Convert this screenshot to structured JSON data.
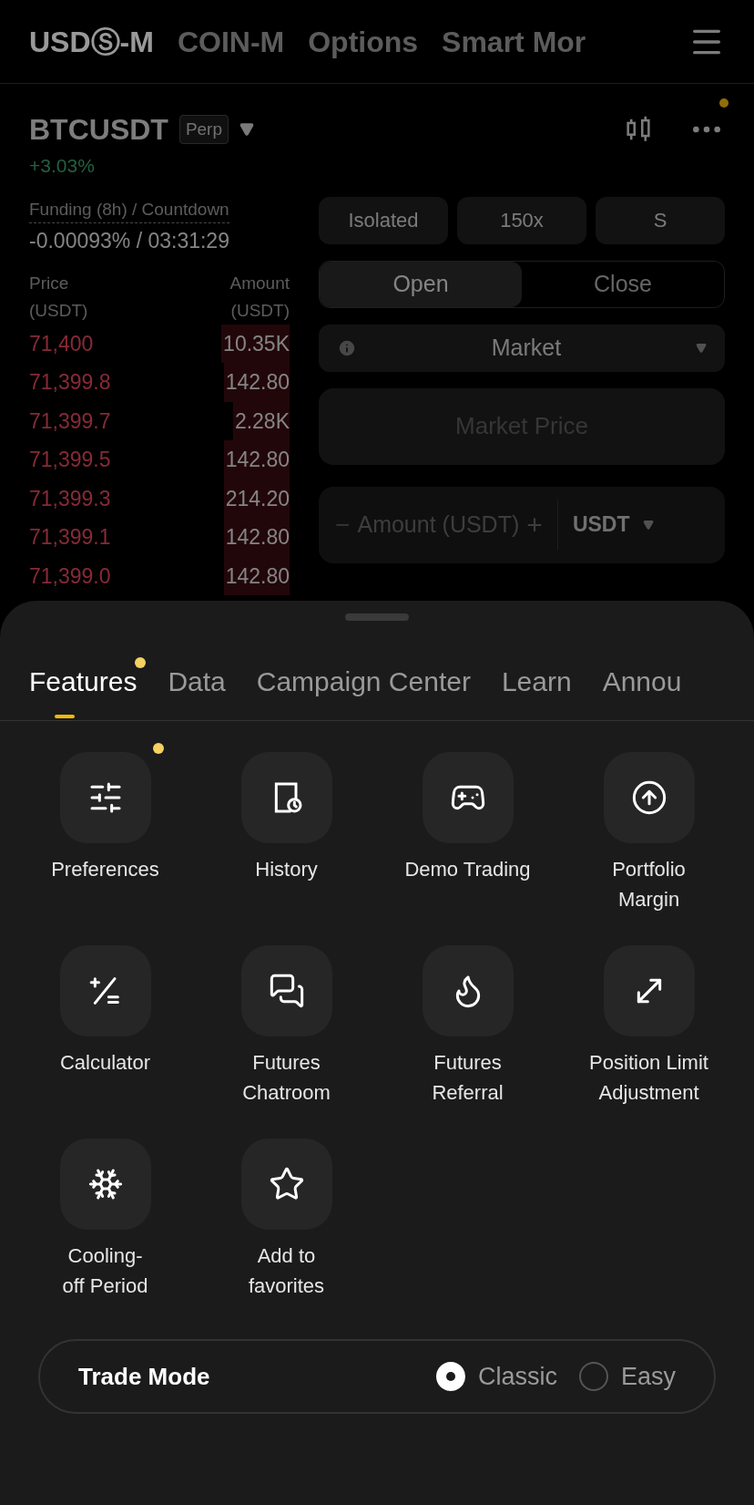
{
  "top_tabs": [
    {
      "label": "USDⓈ-M",
      "selected": true
    },
    {
      "label": "COIN-M",
      "selected": false
    },
    {
      "label": "Options",
      "selected": false
    },
    {
      "label": "Smart Mor",
      "selected": false
    }
  ],
  "symbol": {
    "name": "BTCUSDT",
    "badge": "Perp",
    "change": "+3.03%",
    "more_notification": true
  },
  "funding": {
    "label": "Funding (8h) / Countdown",
    "value": "-0.00093% / 03:31:29"
  },
  "order_book": {
    "columns": [
      "Price\n(USDT)",
      "Amount\n(USDT)"
    ],
    "rows": [
      {
        "price": "71,400",
        "amount": "10.35K"
      },
      {
        "price": "71,399.8",
        "amount": "142.80"
      },
      {
        "price": "71,399.7",
        "amount": "2.28K"
      },
      {
        "price": "71,399.5",
        "amount": "142.80"
      },
      {
        "price": "71,399.3",
        "amount": "214.20"
      },
      {
        "price": "71,399.1",
        "amount": "142.80"
      },
      {
        "price": "71,399.0",
        "amount": "142.80"
      }
    ]
  },
  "order_form": {
    "margin_buttons": [
      "Isolated",
      "150x",
      "S"
    ],
    "sides": [
      {
        "label": "Open",
        "selected": true
      },
      {
        "label": "Close",
        "selected": false
      }
    ],
    "order_type": "Market",
    "price_placeholder": "Market Price",
    "amount_placeholder": "Amount (USDT)",
    "minus": "−",
    "plus": "+",
    "unit": "USDT"
  },
  "sheet": {
    "tabs": [
      {
        "label": "Features",
        "selected": true,
        "dot": true
      },
      {
        "label": "Data",
        "selected": false,
        "dot": false
      },
      {
        "label": "Campaign Center",
        "selected": false,
        "dot": false
      },
      {
        "label": "Learn",
        "selected": false,
        "dot": false
      },
      {
        "label": "Annou",
        "selected": false,
        "dot": false
      }
    ],
    "features": [
      {
        "kind": "sliders",
        "label": "Preferences",
        "dot": true
      },
      {
        "kind": "history",
        "label": "History",
        "dot": false
      },
      {
        "kind": "gamepad",
        "label": "Demo Trading",
        "dot": false
      },
      {
        "kind": "arrow-up-circle",
        "label": "Portfolio\nMargin",
        "dot": false
      },
      {
        "kind": "calculator",
        "label": "Calculator",
        "dot": false
      },
      {
        "kind": "chat",
        "label": "Futures\nChatroom",
        "dot": false
      },
      {
        "kind": "flame",
        "label": "Futures\nReferral",
        "dot": false
      },
      {
        "kind": "expand",
        "label": "Position Limit\nAdjustment",
        "dot": false
      },
      {
        "kind": "snowflake",
        "label": "Cooling-\noff Period",
        "dot": false
      },
      {
        "kind": "star",
        "label": "Add to\nfavorites",
        "dot": false
      }
    ],
    "trade_mode": {
      "label": "Trade Mode",
      "options": [
        {
          "label": "Classic",
          "selected": true
        },
        {
          "label": "Easy",
          "selected": false
        }
      ]
    }
  }
}
